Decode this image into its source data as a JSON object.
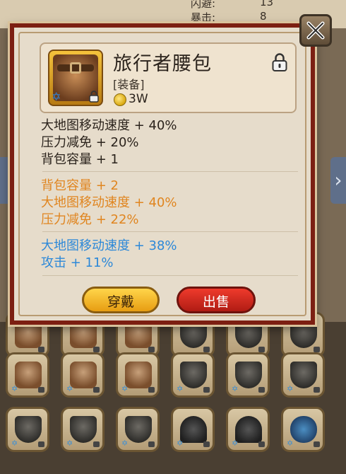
{
  "background": {
    "stats": [
      {
        "label": "闪避:",
        "value": "13"
      },
      {
        "label": "暴击:",
        "value": "8"
      }
    ]
  },
  "popup": {
    "item": {
      "name": "旅行者腰包",
      "type": "[装备]",
      "price": "3W",
      "locked": true
    },
    "base_attrs": [
      "大地图移动速度 + 40%",
      "压力减免 + 20%",
      "背包容量 + 1"
    ],
    "orange_attrs": [
      "背包容量 + 2",
      "大地图移动速度 + 40%",
      "压力减免 + 22%"
    ],
    "blue_attrs": [
      "大地图移动速度 + 38%",
      "攻击 + 11%"
    ],
    "buttons": {
      "equip": "穿戴",
      "sell": "出售"
    }
  },
  "colors": {
    "frame": "#7c1f12",
    "equip_button": "#f2b729",
    "sell_button": "#d72a1e",
    "orange_attr": "#e0851f",
    "blue_attr": "#2c88d8"
  },
  "inventory_icons": [
    "bag-icon",
    "bag-icon",
    "bag-icon",
    "shield-icon",
    "shield-icon",
    "shield-icon",
    "shield-icon",
    "shield-icon",
    "shield-icon",
    "helm-icon",
    "helm-icon",
    "blue-helm-icon"
  ]
}
